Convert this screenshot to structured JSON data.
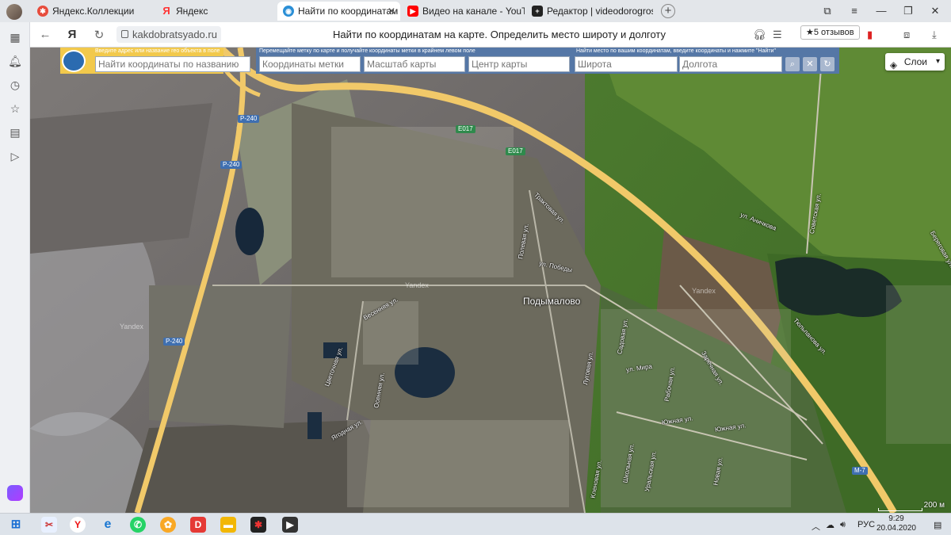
{
  "tabs": [
    {
      "label": "Яндекс.Коллекции",
      "icon": "collections-icon",
      "color": "#e74c3c"
    },
    {
      "label": "Яндекс",
      "icon": "yandex-icon",
      "color": "#ff3333"
    },
    {
      "label": "Найти по координатам",
      "icon": "coords-site-icon",
      "color": "#2b8fd6",
      "close": "✕"
    },
    {
      "label": "Видео на канале - YouTub",
      "icon": "youtube-icon",
      "color": "#ff0000"
    },
    {
      "label": "Редактор | videodorogross",
      "icon": "editor-icon",
      "color": "#222"
    }
  ],
  "new_tab": "+",
  "address": {
    "url": "kakdobratsyado.ru",
    "page_title": "Найти по координатам на карте. Определить место широту и долготу",
    "reviews": "★5 отзывов"
  },
  "search": {
    "left_header": "Введите адрес или название гео объекта в поле",
    "left_placeholder": "Найти координаты по названию",
    "mid_header": "Перемещайте метку по карте и получайте координаты метки в крайнем левом поле",
    "mid_fields": [
      "Координаты метки",
      "Масштаб карты",
      "Центр карты"
    ],
    "right_header": "Найти место по вашим координатам, введите координаты и нажмите \"Найти\"",
    "lat_placeholder": "Широта",
    "lon_placeholder": "Долгота"
  },
  "layers_label": "Слои",
  "map": {
    "roads": [
      "P-240",
      "P-240",
      "P-240",
      "E017",
      "E017",
      "M-7"
    ],
    "village": "Подымалово",
    "watermark": "Yandex",
    "streets": [
      "ул. Аничкова",
      "Тюльпанова ул.",
      "ул. Победы",
      "Трактовая ул.",
      "Весенняя ул.",
      "ул. Мира",
      "Южная ул.",
      "Южная ул.",
      "Полевая ул.",
      "Осенняя ул.",
      "Ягодная ул.",
      "Цветочная ул.",
      "Уральская ул.",
      "Садовая ул.",
      "Школьная ул.",
      "Рабочая ул.",
      "Заречная ул.",
      "Новая ул.",
      "Луговая ул.",
      "Кленовая ул.",
      "Береговая ул.",
      "Советская ул."
    ],
    "scale": "200 м"
  },
  "taskbar": {
    "lang": "РУС",
    "time": "9:29",
    "date": "20.04.2020"
  }
}
